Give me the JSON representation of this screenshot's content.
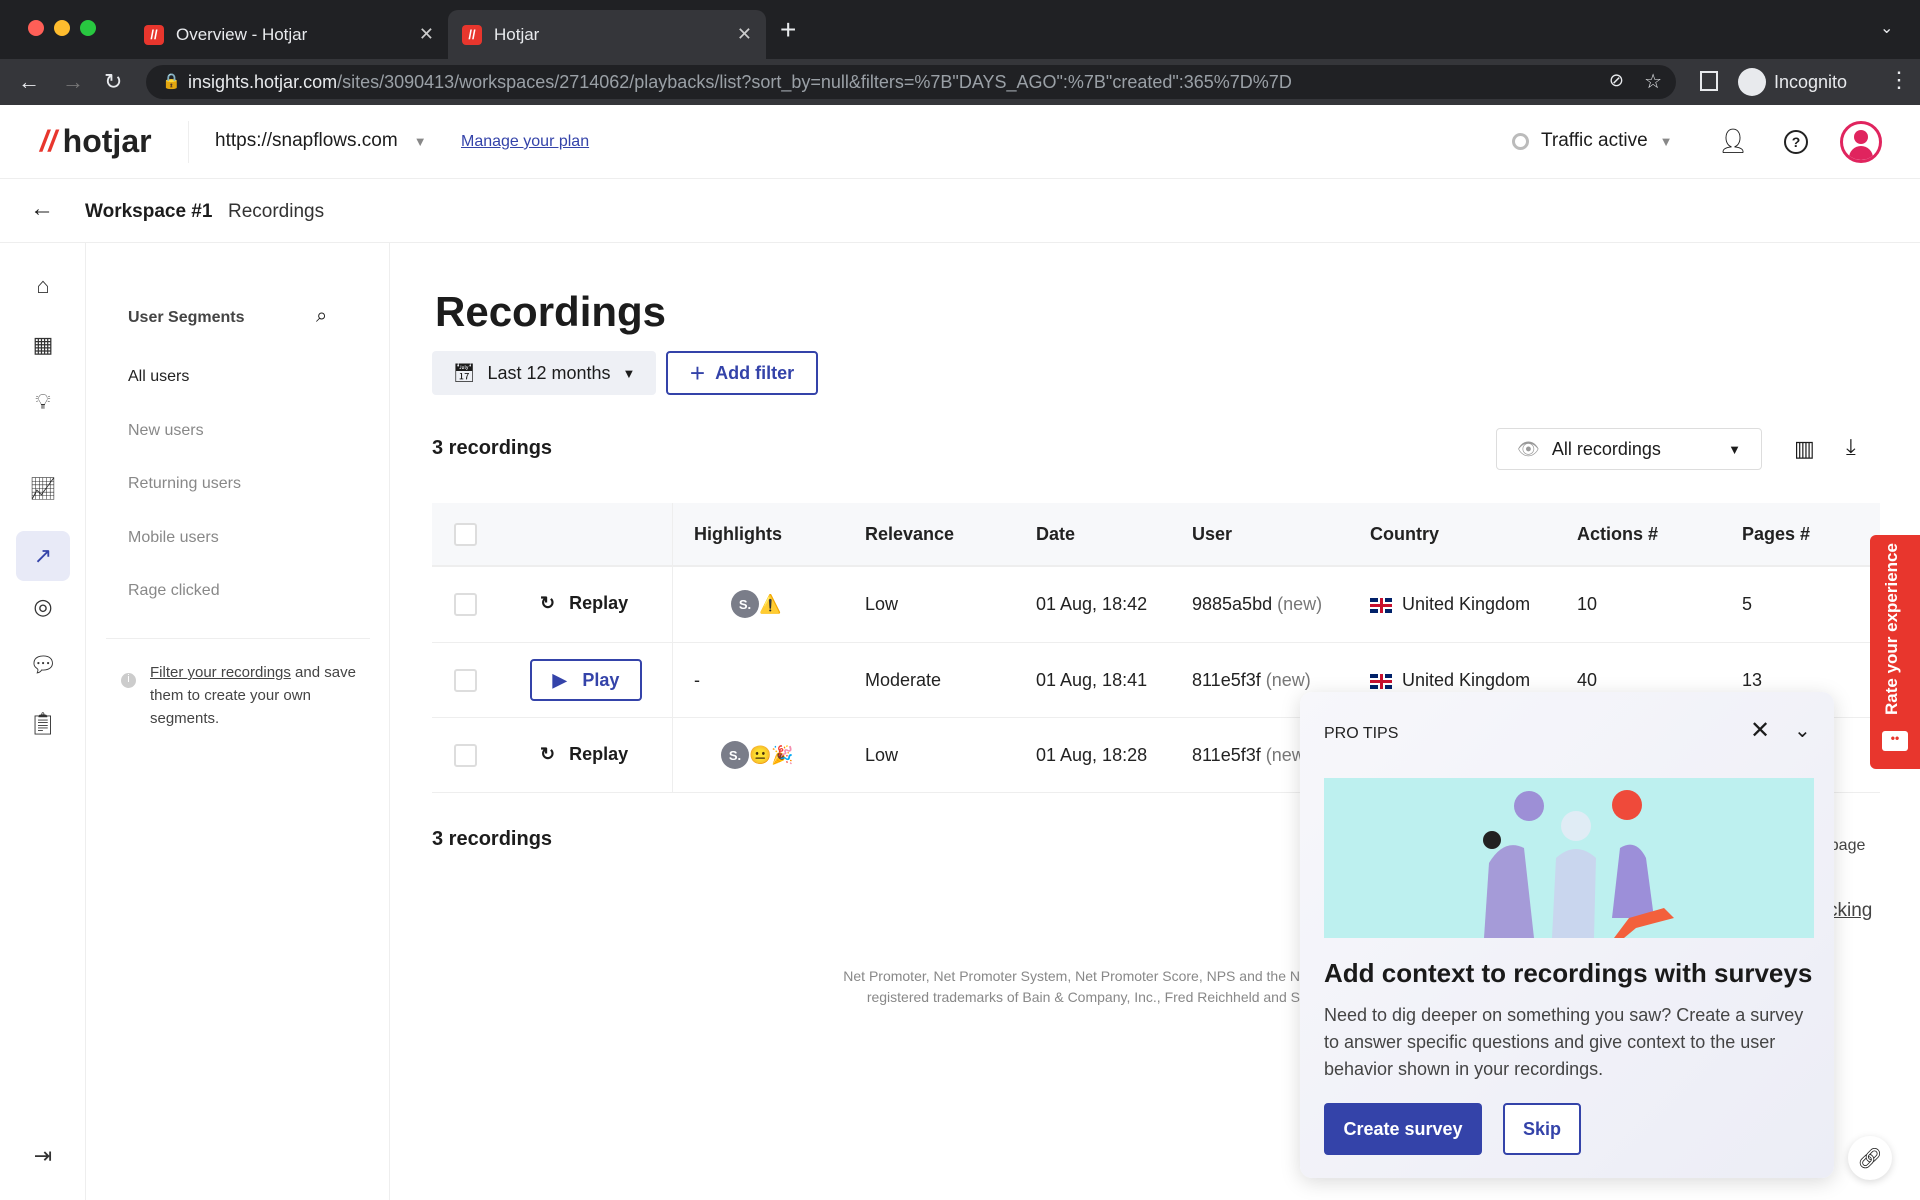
{
  "browser": {
    "tabs": [
      {
        "title": "Overview - Hotjar",
        "active": false
      },
      {
        "title": "Hotjar",
        "active": true
      }
    ],
    "url_host": "insights.hotjar.com",
    "url_path": "/sites/3090413/workspaces/2714062/playbacks/list?sort_by=null&filters=%7B\"DAYS_AGO\":%7B\"created\":365%7D%7D",
    "profile": "Incognito"
  },
  "header": {
    "logo": "hotjar",
    "site": "https://snapflows.com",
    "manage_plan": "Manage your plan",
    "traffic": "Traffic active"
  },
  "breadcrumb": {
    "workspace": "Workspace #1",
    "current": "Recordings"
  },
  "rail": {
    "icons": [
      "home-icon",
      "dashboard-icon",
      "lightbulb-icon",
      "trends-icon",
      "recordings-icon",
      "feedback-icon",
      "surveys-icon",
      "checklist-icon",
      "collapse-icon"
    ]
  },
  "segments": {
    "title": "User Segments",
    "items": [
      "All users",
      "New users",
      "Returning users",
      "Mobile users",
      "Rage clicked"
    ],
    "hint_link": "Filter your recordings",
    "hint_rest": " and save them to create your own segments."
  },
  "main": {
    "title": "Recordings",
    "date_filter": "Last 12 months",
    "add_filter": "Add filter",
    "count": "3 recordings",
    "view_select": "All recordings",
    "columns": [
      "Highlights",
      "Relevance",
      "Date",
      "User",
      "Country",
      "Actions #",
      "Pages #"
    ],
    "rows": [
      {
        "action": "Replay",
        "highlights": [
          "S.",
          "⚠️"
        ],
        "relevance": "Low",
        "date": "01 Aug, 18:42",
        "user": "9885a5bd",
        "user_tag": "(new)",
        "country": "United Kingdom",
        "actions": "10",
        "pages": "5"
      },
      {
        "action": "Play",
        "highlights": [],
        "highlights_text": "-",
        "relevance": "Moderate",
        "date": "01 Aug, 18:41",
        "user": "811e5f3f",
        "user_tag": "(new)",
        "country": "United Kingdom",
        "actions": "40",
        "pages": "13"
      },
      {
        "action": "Replay",
        "highlights": [
          "S.",
          "😐",
          "🎉"
        ],
        "relevance": "Low",
        "date": "01 Aug, 18:28",
        "user": "811e5f3f",
        "user_tag": "(new)",
        "country": "United Kingdom",
        "actions": "",
        "pages": ""
      }
    ],
    "count_bottom": "3 recordings",
    "per_page_fragment": "r page",
    "tracking_fragment": "cking",
    "footer_line1": "Net Promoter, Net Promoter System, Net Promoter Score, NPS and the N",
    "footer_line2": "registered trademarks of Bain & Company, Inc., Fred Reichheld and S"
  },
  "pro_tips": {
    "label": "PRO TIPS",
    "title": "Add context to recordings with surveys",
    "body": "Need to dig deeper on something you saw? Create a survey to answer specific questions and give context to the user behavior shown in your recordings.",
    "primary": "Create survey",
    "secondary": "Skip"
  },
  "rate": "Rate your experience",
  "colors": {
    "accent": "#3443a9",
    "brand": "#e8362d",
    "avatar": "#e0245e"
  }
}
